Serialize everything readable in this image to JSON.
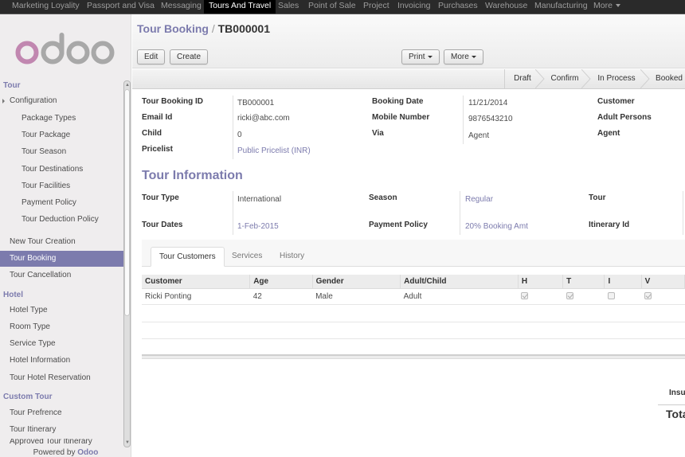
{
  "topnav": {
    "items": [
      "Marketing Loyality",
      "Passport and Visa",
      "Messaging",
      "Tours And Travel",
      "Sales",
      "Point of Sale",
      "Project",
      "Invoicing",
      "Purchases",
      "Warehouse",
      "Manufacturing",
      "More"
    ],
    "active": "Tours And Travel"
  },
  "sidebar": {
    "logo": "odoo",
    "sections": [
      {
        "title": "Tour"
      },
      {
        "title": "Hotel"
      },
      {
        "title": "Custom Tour"
      }
    ],
    "tour_items": [
      "Configuration",
      "Package Types",
      "Tour Package",
      "Tour Season",
      "Tour Destinations",
      "Tour Facilities",
      "Payment Policy",
      "Tour Deduction Policy",
      "New Tour Creation",
      "Tour Booking",
      "Tour Cancellation"
    ],
    "hotel_items": [
      "Hotel Type",
      "Room Type",
      "Service Type",
      "Hotel Information",
      "Tour Hotel Reservation"
    ],
    "custom_items": [
      "Tour Prefrence",
      "Tour Itinerary",
      "Approved Tour Itinerary"
    ],
    "active_item": "Tour Booking",
    "powered_by": "Powered by",
    "powered_brand": "Odoo"
  },
  "header": {
    "breadcrumb_parent": "Tour Booking",
    "separator": "/",
    "record": "TB000001",
    "buttons": {
      "edit": "Edit",
      "create": "Create",
      "print": "Print",
      "more": "More"
    }
  },
  "statusbar": {
    "stages": [
      "Draft",
      "Confirm",
      "In Process",
      "Booked"
    ]
  },
  "form": {
    "labels": {
      "booking_id": "Tour Booking ID",
      "email": "Email Id",
      "child": "Child",
      "pricelist": "Pricelist",
      "booking_date": "Booking Date",
      "mobile": "Mobile Number",
      "via": "Via",
      "customer": "Customer",
      "adult_persons": "Adult Persons",
      "agent": "Agent"
    },
    "values": {
      "booking_id": "TB000001",
      "email": "ricki@abc.com",
      "child": "0",
      "pricelist": "Public Pricelist (INR)",
      "booking_date": "11/21/2014",
      "mobile": "9876543210",
      "via": "Agent"
    },
    "tour_info": {
      "title": "Tour Information",
      "labels": {
        "tour_type": "Tour Type",
        "tour_dates": "Tour Dates",
        "season": "Season",
        "payment_policy": "Payment Policy",
        "tour": "Tour",
        "itinerary": "Itinerary Id"
      },
      "values": {
        "tour_type": "International",
        "tour_dates": "1-Feb-2015",
        "season": "Regular",
        "payment_policy": "20% Booking Amt"
      }
    },
    "tabs": [
      "Tour Customers",
      "Services",
      "History"
    ],
    "active_tab": "Tour Customers",
    "customers_table": {
      "columns": [
        "Customer",
        "Age",
        "Gender",
        "Adult/Child",
        "H",
        "T",
        "I",
        "V"
      ],
      "rows": [
        {
          "customer": "Ricki Ponting",
          "age": "42",
          "gender": "Male",
          "adult_child": "Adult",
          "h": true,
          "t": true,
          "i": false,
          "v": true
        }
      ]
    },
    "totals": {
      "insurance_label": "Insu",
      "total_label": "Tota"
    }
  }
}
